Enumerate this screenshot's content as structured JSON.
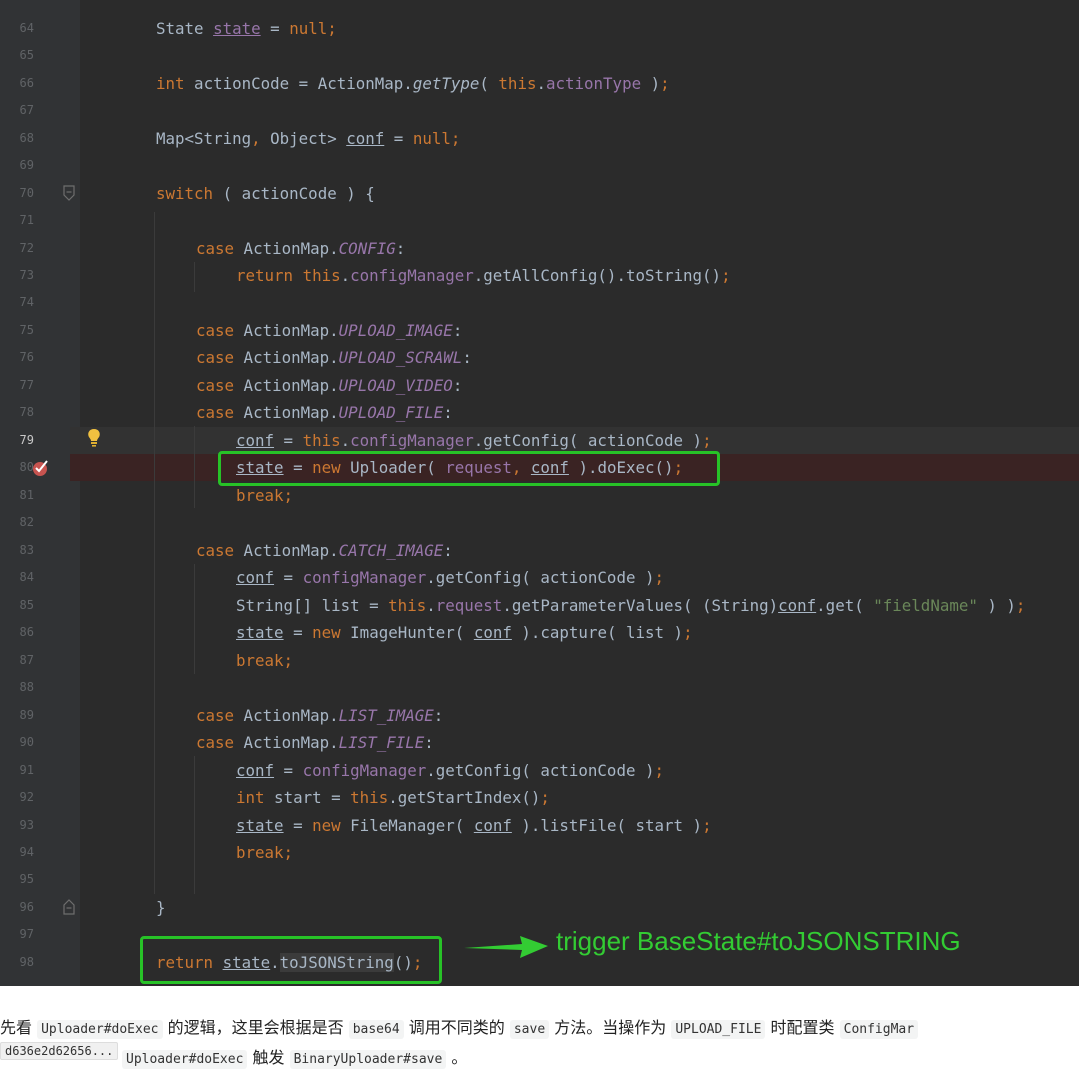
{
  "editor": {
    "line_numbers": [
      "64",
      "65",
      "66",
      "67",
      "68",
      "69",
      "70",
      "71",
      "72",
      "73",
      "74",
      "75",
      "76",
      "77",
      "78",
      "79",
      "80",
      "81",
      "82",
      "83",
      "84",
      "85",
      "86",
      "87",
      "88",
      "89",
      "90",
      "91",
      "92",
      "93",
      "94",
      "95",
      "96",
      "97",
      "98"
    ],
    "current_line": "79",
    "breakpoint_line": "80",
    "colors": {
      "background": "#2b2b2b",
      "keyword": "#cc7832",
      "field": "#9876aa",
      "string": "#6a8759",
      "default": "#a9b7c6",
      "highlight_box": "#27c227",
      "breakpoint_line": "#3a2323"
    }
  },
  "annotation": {
    "text": "trigger BaseState#toJSONSTRING",
    "color": "#33cc33"
  },
  "footer": {
    "line1": {
      "t1": "先看 ",
      "c1": "Uploader#doExec",
      "t2": " 的逻辑，这里会根据是否 ",
      "c2": "base64",
      "t3": " 调用不同类的 ",
      "c3": "save",
      "t4": " 方法。当操作为 ",
      "c4": "UPLOAD_FILE",
      "t5": " 时配置类 ",
      "c5": "ConfigMar"
    },
    "hash": "d636e2d62656...",
    "line2": {
      "c1": "Uploader#doExec",
      "t1": " 触发 ",
      "c2": "BinaryUploader#save",
      "t2": " 。"
    }
  }
}
